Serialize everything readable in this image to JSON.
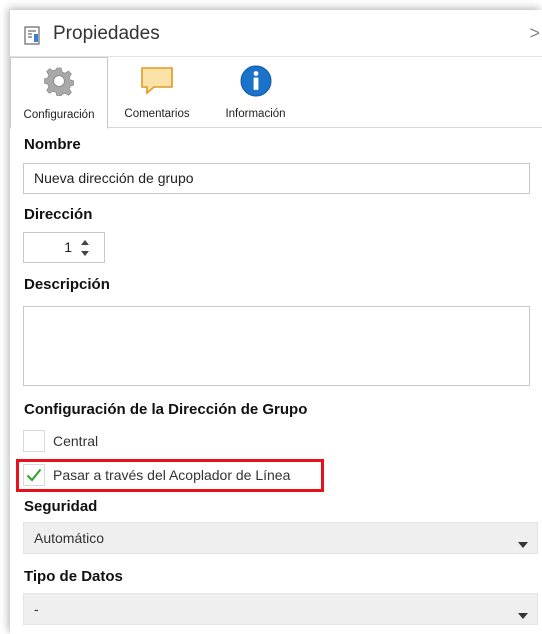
{
  "window": {
    "title": "Propiedades"
  },
  "tabs": [
    {
      "label": "Configuración",
      "icon": "gear-icon"
    },
    {
      "label": "Comentarios",
      "icon": "comment-icon"
    },
    {
      "label": "Información",
      "icon": "info-icon"
    }
  ],
  "form": {
    "name_label": "Nombre",
    "name_value": "Nueva dirección de grupo",
    "address_label": "Dirección",
    "address_value": "1",
    "description_label": "Descripción",
    "description_value": "",
    "group_config_label": "Configuración de la Dirección de Grupo",
    "central_label": "Central",
    "central_checked": false,
    "pass_through_label": "Pasar a través del Acoplador de Línea",
    "pass_through_checked": true,
    "security_label": "Seguridad",
    "security_value": "Automático",
    "datatype_label": "Tipo de Datos",
    "datatype_value": "-"
  },
  "colors": {
    "highlight": "#e8101a",
    "check": "#2aa12a",
    "info": "#1a72c9",
    "comment": "#f5b640"
  }
}
